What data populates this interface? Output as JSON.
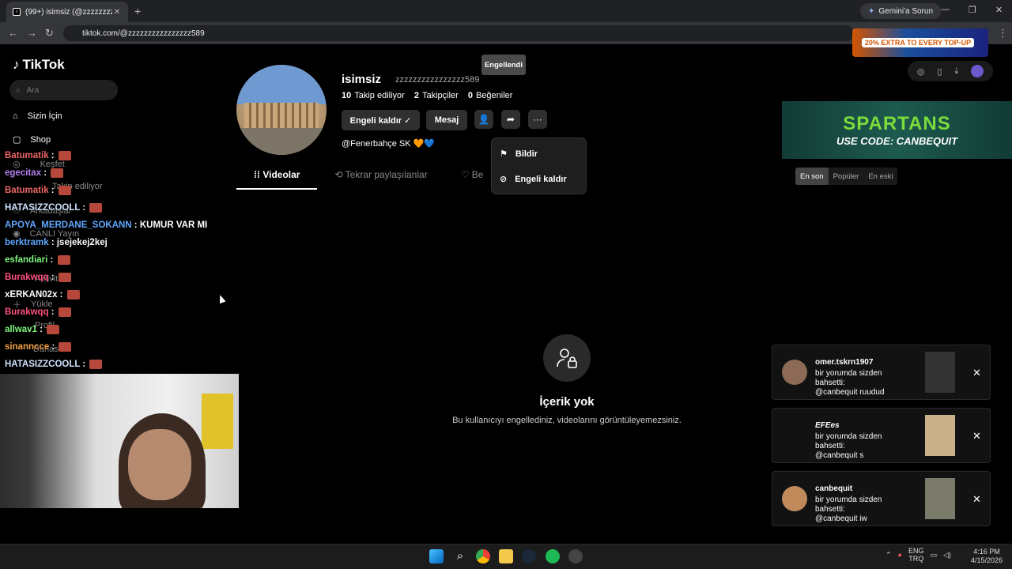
{
  "browser": {
    "tab_title": "(99+) isimsiz (@zzzzzzzzzzzzzzzzz",
    "new_tab": "+",
    "gemini_button": "Gemini'a Sorun",
    "url": "tiktok.com/@zzzzzzzzzzzzzzzz589",
    "promo_text": "20% EXTRA TO EVERY TOP-UP"
  },
  "sidebar": {
    "logo": "TikTok",
    "search_placeholder": "Ara",
    "items": [
      {
        "label": "Sizin İçin"
      },
      {
        "label": "Shop"
      },
      {
        "label": "Keşfet"
      },
      {
        "label": "Takip ediliyor"
      },
      {
        "label": "Arkadaşlar"
      },
      {
        "label": "CANLI Yayın"
      },
      {
        "label": "Aktivite"
      },
      {
        "label": "Yükle"
      },
      {
        "label": "Profil"
      },
      {
        "label": "Dahası"
      }
    ]
  },
  "chat": [
    {
      "user": "Batumatik",
      "msg": "",
      "color": "#e66"
    },
    {
      "user": "egecitax",
      "msg": "",
      "color": "#b77ef0"
    },
    {
      "user": "Batumatik",
      "msg": "",
      "color": "#e66"
    },
    {
      "user": "HATASIZZCOOLL",
      "msg": "",
      "color": "#cfe2ff"
    },
    {
      "user": "APOYA_MERDANE_SOKANN",
      "msg": "KUMUR VAR MI",
      "color": "#5fa8ff"
    },
    {
      "user": "berktramk",
      "msg": "jsejekej2kej",
      "color": "#5fa8ff"
    },
    {
      "user": "esfandiari",
      "msg": "",
      "color": "#7ef57e"
    },
    {
      "user": "Burakwqq",
      "msg": "",
      "color": "#ff4f7f"
    },
    {
      "user": "xERKAN02x",
      "msg": "",
      "color": "#fff"
    },
    {
      "user": "Burakwqq",
      "msg": "",
      "color": "#ff4f7f"
    },
    {
      "user": "allwav1",
      "msg": "",
      "color": "#7ef57e"
    },
    {
      "user": "sinanncce",
      "msg": "",
      "color": "#f0a040"
    },
    {
      "user": "HATASIZZCOOLL",
      "msg": "",
      "color": "#cfe2ff"
    }
  ],
  "profile": {
    "display_name": "isimsiz",
    "handle": "zzzzzzzzzzzzzzzz589",
    "following_count": "10",
    "following_label": "Takip ediliyor",
    "followers_count": "2",
    "followers_label": "Takipçiler",
    "likes_count": "0",
    "likes_label": "Beğeniler",
    "unblock_label": "Engeli kaldır ✓",
    "message_label": "Mesaj",
    "bio": "@Fenerbahçe SK 🧡💙",
    "blocked_tooltip": "Engellendi"
  },
  "dropdown": {
    "report_label": "Bildir",
    "unblock_label": "Engeli kaldır"
  },
  "tabs": {
    "videos": "Videolar",
    "reposts": "Tekrar paylaşılanlar",
    "liked": "Be"
  },
  "sort": {
    "latest": "En son",
    "popular": "Popüler",
    "oldest": "En eski"
  },
  "empty_state": {
    "title": "İçerik yok",
    "subtitle": "Bu kullanıcıyı engellediniz, videolarını görüntüleyemezsiniz."
  },
  "ad": {
    "brand": "SPARTANS",
    "code": "USE CODE: CANBEQUIT"
  },
  "notifications": [
    {
      "name": "omer.tskrn1907",
      "line1": "bir yorumda sizden bahsetti:",
      "line2": "@canbequit ruudud",
      "avatar_color": "#8c6a55"
    },
    {
      "name": "EFEes",
      "line1": "bir yorumda sizden bahsetti:",
      "line2": "@canbequit s",
      "avatar_color": "#111"
    },
    {
      "name": "canbequit",
      "line1": "bir yorumda sizden bahsetti:",
      "line2": "@canbequit iw",
      "avatar_color": "#c08a5a"
    }
  ],
  "taskbar": {
    "lang": "ENG",
    "region": "TRQ",
    "time": "4:16 PM",
    "date": "4/15/2026"
  }
}
